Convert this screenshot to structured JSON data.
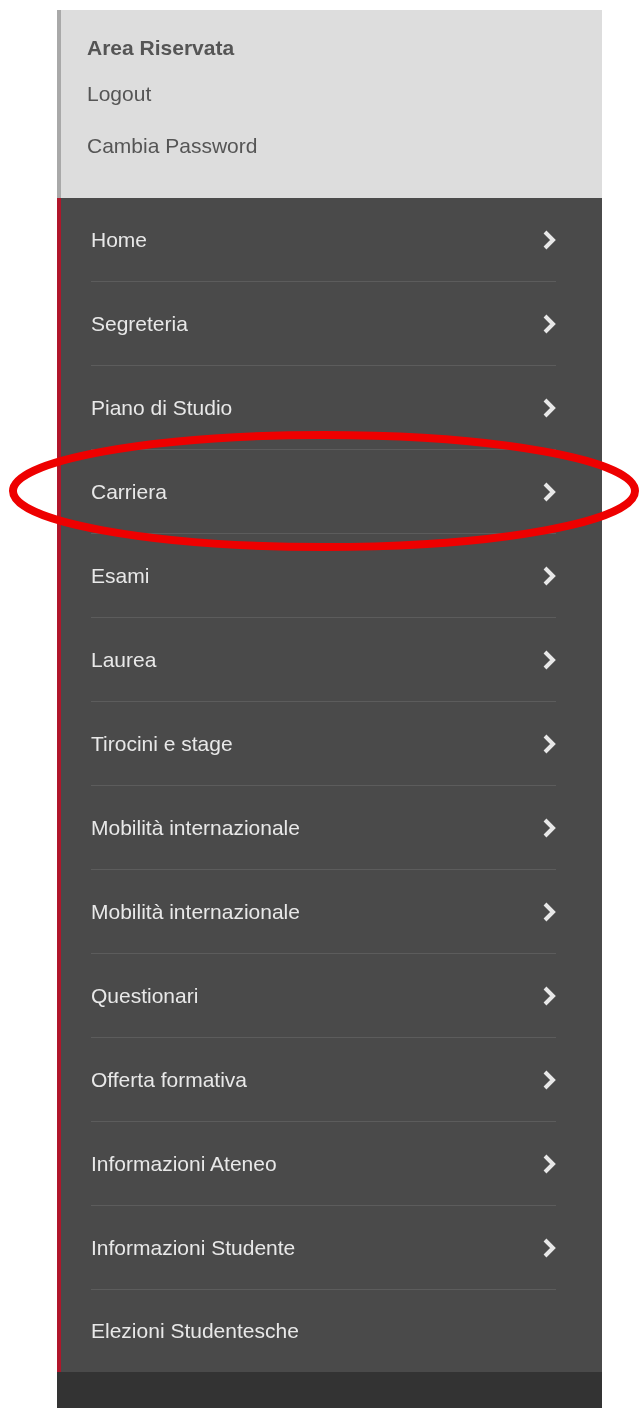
{
  "header": {
    "title": "Area Riservata",
    "links": [
      "Logout",
      "Cambia Password"
    ]
  },
  "menu": [
    {
      "label": "Home",
      "kind": "arrow",
      "highlighted": false
    },
    {
      "label": "Segreteria",
      "kind": "arrow",
      "highlighted": false
    },
    {
      "label": "Piano di Studio",
      "kind": "arrow",
      "highlighted": false
    },
    {
      "label": "Carriera",
      "kind": "arrow",
      "highlighted": true
    },
    {
      "label": "Esami",
      "kind": "arrow",
      "highlighted": false
    },
    {
      "label": "Laurea",
      "kind": "arrow",
      "highlighted": false
    },
    {
      "label": "Tirocini e stage",
      "kind": "arrow",
      "highlighted": false
    },
    {
      "label": "Mobilità internazionale",
      "kind": "arrow",
      "highlighted": false
    },
    {
      "label": "Mobilità internazionale",
      "kind": "arrow",
      "highlighted": false
    },
    {
      "label": "Questionari",
      "kind": "arrow",
      "highlighted": false
    },
    {
      "label": "Offerta formativa",
      "kind": "arrow",
      "highlighted": false
    },
    {
      "label": "Informazioni Ateneo",
      "kind": "arrow",
      "highlighted": false
    },
    {
      "label": "Informazioni Studente",
      "kind": "arrow",
      "highlighted": false
    },
    {
      "label": "Elezioni Studentesche",
      "kind": "plain",
      "highlighted": false
    }
  ]
}
